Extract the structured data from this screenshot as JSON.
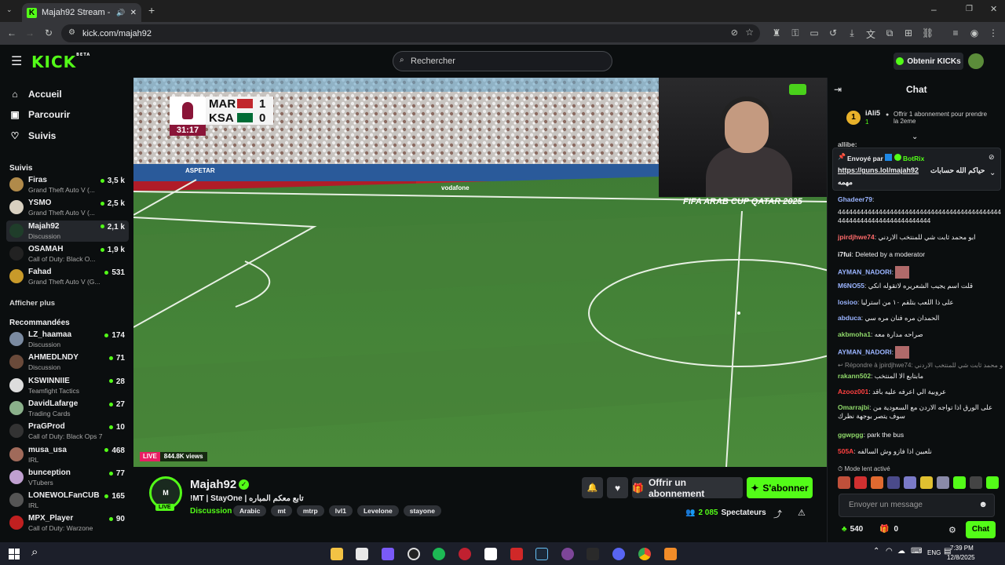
{
  "browser": {
    "tab_title": "Majah92 Stream - Watch Li",
    "url": "kick.com/majah92"
  },
  "header": {
    "logo": "KICK",
    "logo_badge": "BETA",
    "search_placeholder": "Rechercher",
    "get_kicks": "Obtenir KICKs"
  },
  "sidebar": {
    "nav": [
      {
        "label": "Accueil",
        "icon": "home-icon"
      },
      {
        "label": "Parcourir",
        "icon": "browse-icon"
      },
      {
        "label": "Suivis",
        "icon": "heart-icon"
      }
    ],
    "following_title": "Suivis",
    "following": [
      {
        "name": "Firas",
        "category": "Grand Theft Auto V (...",
        "viewers": "3,5 k",
        "color": "#b08a4a"
      },
      {
        "name": "YSMO",
        "category": "Grand Theft Auto V (...",
        "viewers": "2,5 k",
        "color": "#d8d0c0"
      },
      {
        "name": "Majah92",
        "category": "Discussion",
        "viewers": "2,1 k",
        "color": "#1f3d2a"
      },
      {
        "name": "OSAMAH",
        "category": "Call of Duty: Black O...",
        "viewers": "1,9 k",
        "color": "#222"
      },
      {
        "name": "Fahad",
        "category": "Grand Theft Auto V (G...",
        "viewers": "531",
        "color": "#c89a2a"
      }
    ],
    "show_more": "Afficher plus",
    "recommended_title": "Recommandées",
    "recommended": [
      {
        "name": "LZ_haamaa",
        "category": "Discussion",
        "viewers": "174",
        "color": "#7a8aa0"
      },
      {
        "name": "AHMEDLNDY",
        "category": "Discussion",
        "viewers": "71",
        "color": "#6a4a3a"
      },
      {
        "name": "KSWINNIIE",
        "category": "Teamfight Tactics",
        "viewers": "28",
        "color": "#ddd"
      },
      {
        "name": "DavidLafarge",
        "category": "Trading Cards",
        "viewers": "27",
        "color": "#8ab08a"
      },
      {
        "name": "PraGProd",
        "category": "Call of Duty: Black Ops 7",
        "viewers": "10",
        "color": "#333"
      },
      {
        "name": "musa_usa",
        "category": "IRL",
        "viewers": "468",
        "color": "#a06a5a"
      },
      {
        "name": "bunception",
        "category": "VTubers",
        "viewers": "77",
        "color": "#c0a0d0"
      },
      {
        "name": "LONEWOLFanCUB",
        "category": "IRL",
        "viewers": "165",
        "color": "#555"
      },
      {
        "name": "MPX_Player",
        "category": "Call of Duty: Warzone",
        "viewers": "90",
        "color": "#c02020"
      }
    ]
  },
  "video": {
    "score_team1": "MAR",
    "score1": "1",
    "score_team2": "KSA",
    "score2": "0",
    "clock": "31:17",
    "banner": "FIFA ARAB CUP QATAR 2025",
    "live_badge": "LIVE",
    "views": "844.8K views",
    "ad_board": "vodafone",
    "ad_board2": "ASPETAR"
  },
  "stream": {
    "channel": "Majah92",
    "title": "!MT | StayOne | تابع معكم المباره",
    "category": "Discussion",
    "tags": [
      "Arabic",
      "mt",
      "mtrp",
      "lvl1",
      "Levelone",
      "stayone"
    ],
    "viewers": "2 085",
    "viewers_label": "Spectateurs",
    "subscribe_gift": "Offrir un abonnement",
    "subscribe": "S'abonner",
    "avatar_live": "LIVE"
  },
  "chat": {
    "title": "Chat",
    "gift_user": "iAli5",
    "gift_count": "1",
    "gift_text": "Offrir 1 abonnement pour prendre la 2eme",
    "pinned_by_label": "Envoyé par",
    "pinned_by": "BotRix",
    "pinned_link": "https://guns.lol/majah92",
    "pinned_text": "حياكم الله حسابات",
    "pinned_text2": "مهمه",
    "partial_user": "allibe:",
    "messages": [
      {
        "user": "Ghadeer79",
        "text": "",
        "color": "#9ab4ff"
      },
      {
        "user": "",
        "text": "444444444444444444444444444444444444444444444444444444444444444444444",
        "color": "#efeff1"
      },
      {
        "user": "jpirdjhwe74",
        "text": "ابو محمد ثابت شي للمنتخب الاردني",
        "color": "#ff6b6b"
      },
      {
        "user": "i7fui",
        "text": "Deleted by a moderator",
        "color": "#efeff1"
      },
      {
        "user": "AYMAN_NADORI",
        "text": "",
        "color": "#9ab4ff"
      },
      {
        "user": "M6NO55",
        "text": "قلت اسم يجيب الشعريره لاتقوله انكي",
        "color": "#9ab4ff"
      },
      {
        "user": "losioo",
        "text": "على ذا اللعب بتلقم ١٠ من استرليا",
        "color": "#9ab4ff"
      },
      {
        "user": "abduca",
        "text": "الحمدان مره فنان مره سي",
        "color": "#9ab4ff"
      },
      {
        "user": "akbmoha1",
        "text": "صراحه مدارة معه",
        "color": "#8fd86a"
      },
      {
        "user": "AYMAN_NADORI",
        "text": "",
        "color": "#9ab4ff"
      },
      {
        "user": "rakann502",
        "text": "مابتابع الا المنتخب",
        "color": "#8fd86a"
      },
      {
        "user": "Azooz001",
        "text": "عروبية الي اعرفه عليه باقد",
        "color": "#ff4040"
      },
      {
        "user": "Omarrajbi",
        "text": "على الورق اذا تواجه الاردن مع السعودية من سوف يتصر بوجهة نظرك",
        "color": "#8fd86a"
      },
      {
        "user": "ggwpgg",
        "text": "park the bus",
        "color": "#8fd86a"
      },
      {
        "user": "505A",
        "text": "نلعبين اذا فازو وش السالفه",
        "color": "#ff4040"
      }
    ],
    "reply_label": "Répondre à jpirdjhwe74:",
    "reply_text": "ابو محمد ثابت شي للمنتخب الاردني",
    "slow_mode": "Mode lent activé",
    "placeholder": "Envoyer un message",
    "kicks": "540",
    "gifts": "0",
    "send": "Chat"
  },
  "taskbar": {
    "lang": "ENG",
    "time": "7:39 PM",
    "date": "12/8/2025"
  }
}
